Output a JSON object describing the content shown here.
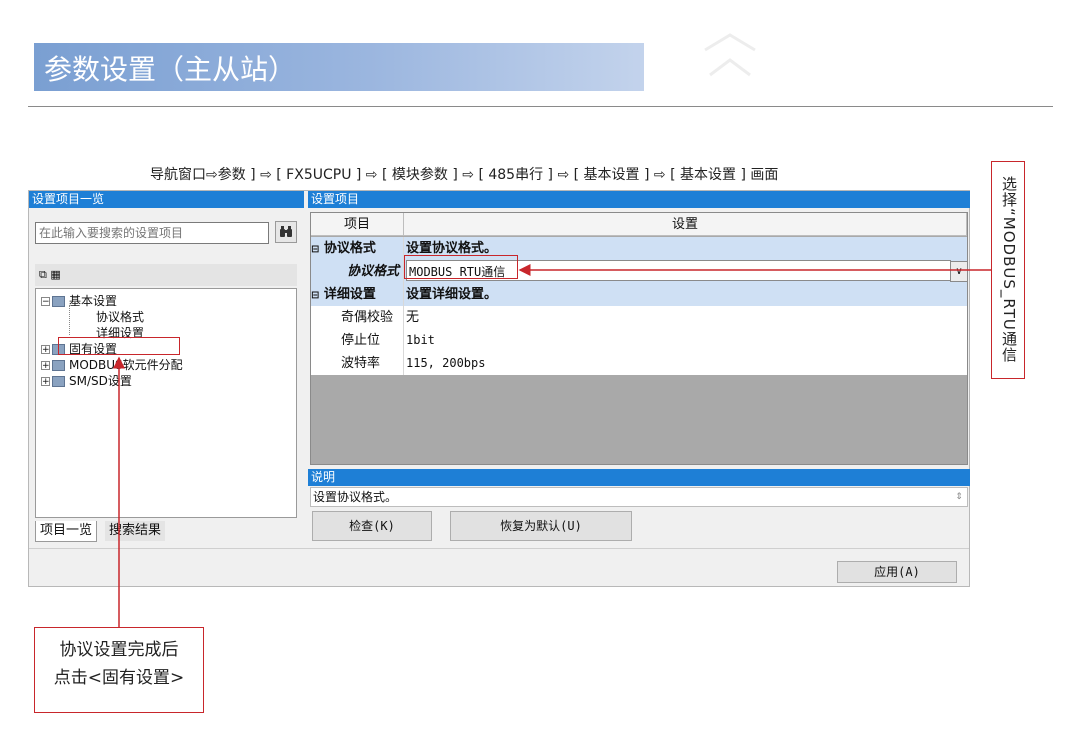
{
  "slide": {
    "title": "参数设置（主从站）",
    "nav_path": "导航窗口⇨参数 ] ⇨ [ FX5UCPU ] ⇨ [ 模块参数 ] ⇨ [ 485串行 ] ⇨ [ 基本设置 ] ⇨ [ 基本设置 ] 画面"
  },
  "left_pane": {
    "header": "设置项目一览",
    "search_placeholder": "在此输入要搜索的设置项目",
    "search_button_icon": "binoculars-icon",
    "toolbar_icons": "⧉ ▦",
    "tree": [
      {
        "label": "基本设置",
        "toggle": "−",
        "children": [
          "协议格式",
          "详细设置"
        ]
      },
      {
        "label": "固有设置",
        "toggle": "+"
      },
      {
        "label": "MODBUS软元件分配",
        "toggle": "+"
      },
      {
        "label": "SM/SD设置",
        "toggle": "+"
      }
    ],
    "tabs": [
      "项目一览",
      "搜索结果"
    ]
  },
  "right_pane": {
    "header": "设置项目",
    "columns": [
      "项目",
      "设置"
    ],
    "rows": [
      {
        "type": "group",
        "item": "协议格式",
        "setting": "设置协议格式。"
      },
      {
        "type": "select",
        "item": "协议格式",
        "setting": "MODBUS_RTU通信"
      },
      {
        "type": "group",
        "item": "详细设置",
        "setting": "设置详细设置。"
      },
      {
        "type": "value",
        "item": "奇偶校验",
        "setting": "无"
      },
      {
        "type": "value",
        "item": "停止位",
        "setting": "1bit"
      },
      {
        "type": "value",
        "item": "波特率",
        "setting": "115, 200bps"
      }
    ],
    "description_header": "说明",
    "description": "设置协议格式。",
    "buttons": {
      "check": "检查(K)",
      "restore": "恢复为默认(U)",
      "apply": "应用(A)"
    }
  },
  "annotations": {
    "right_callout": "选择“MODBUS_RTU通信",
    "left_callout": "协议设置完成后\n点击<固有设置>"
  },
  "colors": {
    "accent_red": "#c8262b",
    "header_blue": "#1e7fd6",
    "title_bar": "#7a9fd2"
  }
}
